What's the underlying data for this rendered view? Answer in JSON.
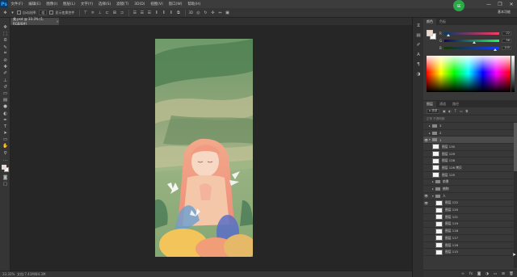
{
  "app": {
    "logo": "Ps",
    "menu": [
      "文件(F)",
      "编辑(E)",
      "图像(I)",
      "图层(L)",
      "文字(Y)",
      "选择(S)",
      "滤镜(T)",
      "3D(D)",
      "视图(V)",
      "窗口(W)",
      "帮助(H)"
    ],
    "window_controls": [
      "—",
      "❐",
      "✕"
    ],
    "user_badge": "SE"
  },
  "options_bar": {
    "auto_select_label": "自动选择:",
    "auto_select_value": "组",
    "show_transform_label": "显示变换控件",
    "workspace": "基本功能"
  },
  "document": {
    "tab_title": "美.psd @ 33.3% (1, RGB/8#)",
    "tab_close": "×"
  },
  "status": {
    "zoom": "33.33%",
    "doc_size": "文档:7.41M/84.3M"
  },
  "color_panel": {
    "tabs": [
      "颜色",
      "色板"
    ],
    "sliders": [
      {
        "label": "R",
        "value": "22",
        "thumb_pos": 0.08
      },
      {
        "label": "G",
        "value": "56",
        "thumb_pos": 0.55
      },
      {
        "label": "B",
        "value": "100",
        "thumb_pos": 0.93
      }
    ],
    "foreground": "#f1d7c8",
    "background": "#ffffff"
  },
  "layers_panel": {
    "tabs": [
      "图层",
      "通道",
      "路径"
    ],
    "filter_label": "ρ 类型",
    "blend_row": "正常   不透明度:",
    "layers": [
      {
        "type": "folder",
        "name": "3",
        "visible": false,
        "open": false,
        "indent": 0
      },
      {
        "type": "folder",
        "name": "2",
        "visible": false,
        "open": false,
        "indent": 0
      },
      {
        "type": "folder",
        "name": "1",
        "visible": true,
        "open": true,
        "indent": 0,
        "selected": true
      },
      {
        "type": "layer",
        "name": "图层 130",
        "visible": false,
        "indent": 1
      },
      {
        "type": "layer",
        "name": "图层 129",
        "visible": false,
        "indent": 1
      },
      {
        "type": "layer",
        "name": "图层 128",
        "visible": false,
        "indent": 1
      },
      {
        "type": "layer",
        "name": "图层 126 拷贝",
        "visible": false,
        "indent": 1
      },
      {
        "type": "layer",
        "name": "图层 125",
        "visible": false,
        "indent": 1
      },
      {
        "type": "folder",
        "name": "前景",
        "visible": false,
        "open": false,
        "indent": 1
      },
      {
        "type": "folder",
        "name": "植物",
        "visible": false,
        "open": false,
        "indent": 1
      },
      {
        "type": "folder",
        "name": "人",
        "visible": true,
        "open": true,
        "indent": 1
      },
      {
        "type": "layer",
        "name": "图层 122",
        "visible": true,
        "indent": 2
      },
      {
        "type": "layer",
        "name": "图层 120",
        "visible": false,
        "indent": 2
      },
      {
        "type": "layer",
        "name": "图层 121",
        "visible": false,
        "indent": 2
      },
      {
        "type": "layer",
        "name": "图层 119",
        "visible": false,
        "indent": 2
      },
      {
        "type": "layer",
        "name": "图层 118",
        "visible": false,
        "indent": 2
      },
      {
        "type": "layer",
        "name": "图层 117",
        "visible": false,
        "indent": 2
      },
      {
        "type": "layer",
        "name": "图层 116",
        "visible": false,
        "indent": 2
      },
      {
        "type": "layer",
        "name": "图层 115",
        "visible": false,
        "indent": 2
      }
    ],
    "bottom_icons": [
      "link-icon",
      "fx-icon",
      "mask-icon",
      "adjustment-icon",
      "new-group-icon",
      "new-layer-icon",
      "trash-icon"
    ]
  },
  "tools": [
    "move-tool-icon",
    "marquee-tool-icon",
    "lasso-tool-icon",
    "quick-select-tool-icon",
    "crop-tool-icon",
    "eyedropper-tool-icon",
    "healing-tool-icon",
    "brush-tool-icon",
    "clone-stamp-tool-icon",
    "history-brush-tool-icon",
    "eraser-tool-icon",
    "gradient-tool-icon",
    "blur-tool-icon",
    "dodge-tool-icon",
    "pen-tool-icon",
    "type-tool-icon",
    "path-select-tool-icon",
    "shape-tool-icon",
    "hand-tool-icon",
    "zoom-tool-icon"
  ]
}
